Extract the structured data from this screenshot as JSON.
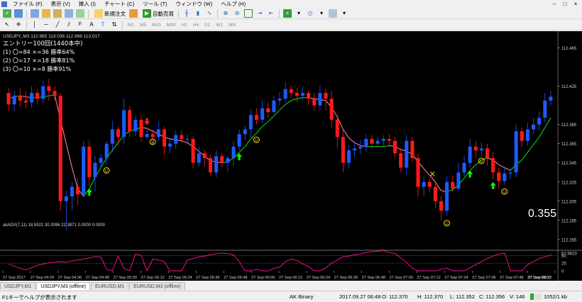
{
  "menu": {
    "items": [
      "ファイル (F)",
      "表示 (V)",
      "挿入 (I)",
      "チャート (C)",
      "ツール (T)",
      "ウィンドウ (W)",
      "ヘルプ (H)"
    ],
    "window_controls": [
      "–",
      "□",
      "×"
    ]
  },
  "toolbar": {
    "new_order": "新規注文",
    "auto_trading": "自動売買",
    "timeframes": [
      "M1",
      "M5",
      "M15",
      "M30",
      "H1",
      "H4",
      "D1",
      "W1",
      "MN"
    ]
  },
  "chart": {
    "header": "USDJPY,,M3   112.985 113.036 112.966 113.017",
    "info_lines": [
      "エントリー100回(1440本中)",
      "(1) 〇=84 ×=36 勝率64%",
      "(2) 〇=17 ×=18 勝率81%",
      "(3) 〇=10 ×=8 勝率91%"
    ],
    "big_value": "0.355",
    "indicator_label": "akADX(7,11) 18.5921 30.3096 22.3871 0.0000 0.0000",
    "colors": {
      "bull": "#1e5aff",
      "bear": "#ff1a1a",
      "ma_up": "#00d800",
      "ma_down": "#ff7a9a",
      "adx": "#ff1493",
      "up_arrow": "#00ff00",
      "down_arrow": "#ff2020",
      "smiley": "#ffd700",
      "bg": "#000000",
      "grid": "#252525"
    }
  },
  "chart_data": {
    "type": "candlestick",
    "symbol": "USDJPY",
    "timeframe": "M3",
    "price_ticks": [
      "112.465",
      "112.425",
      "112.385",
      "112.365",
      "112.345",
      "112.325",
      "112.305",
      "112.285",
      "112.265"
    ],
    "price_range": [
      112.256,
      112.478
    ],
    "time_labels": [
      "27 Sep 2017",
      "27 Sep 04:24",
      "27 Sep 04:36",
      "27 Sep 04:48",
      "27 Sep 05:00",
      "27 Sep 05:12",
      "27 Sep 05:24",
      "27 Sep 05:36",
      "27 Sep 05:48",
      "27 Sep 06:00",
      "27 Sep 06:12",
      "27 Sep 06:24",
      "27 Sep 06:36",
      "27 Sep 06:48",
      "27 Sep 07:00",
      "27 Sep 07:12",
      "27 Sep 07:24",
      "27 Sep 07:36",
      "27 Sep 07:48",
      "27 Sep 08:00",
      "27 Sep 08:12"
    ],
    "candles": [
      [
        112.418,
        112.406,
        112.423,
        112.399
      ],
      [
        112.406,
        112.415,
        112.42,
        112.399
      ],
      [
        112.415,
        112.41,
        112.423,
        112.404
      ],
      [
        112.41,
        112.408,
        112.42,
        112.402
      ],
      [
        112.408,
        112.418,
        112.425,
        112.403
      ],
      [
        112.418,
        112.412,
        112.422,
        112.406
      ],
      [
        112.412,
        112.425,
        112.431,
        112.407
      ],
      [
        112.425,
        112.42,
        112.433,
        112.41
      ],
      [
        112.42,
        112.415,
        112.425,
        112.41
      ],
      [
        112.415,
        112.305,
        112.418,
        112.295
      ],
      [
        112.305,
        112.31,
        112.316,
        112.275
      ],
      [
        112.31,
        112.32,
        112.325,
        112.295
      ],
      [
        112.32,
        112.312,
        112.329,
        112.301
      ],
      [
        112.312,
        112.362,
        112.368,
        112.309
      ],
      [
        112.362,
        112.33,
        112.369,
        112.321
      ],
      [
        112.33,
        112.345,
        112.352,
        112.315
      ],
      [
        112.345,
        112.35,
        112.354,
        112.34
      ],
      [
        112.35,
        112.365,
        112.368,
        112.343
      ],
      [
        112.365,
        112.38,
        112.389,
        112.356
      ],
      [
        112.38,
        112.372,
        112.383,
        112.363
      ],
      [
        112.372,
        112.4,
        112.412,
        112.365
      ],
      [
        112.4,
        112.378,
        112.404,
        112.372
      ],
      [
        112.378,
        112.39,
        112.394,
        112.373
      ],
      [
        112.39,
        112.372,
        112.395,
        112.367
      ],
      [
        112.372,
        112.375,
        112.38,
        112.37
      ],
      [
        112.375,
        112.372,
        112.38,
        112.364
      ],
      [
        112.372,
        112.38,
        112.388,
        112.368
      ],
      [
        112.38,
        112.362,
        112.383,
        112.353
      ],
      [
        112.362,
        112.365,
        112.37,
        112.355
      ],
      [
        112.365,
        112.374,
        112.379,
        112.36
      ],
      [
        112.374,
        112.37,
        112.379,
        112.366
      ],
      [
        112.37,
        112.37,
        112.375,
        112.364
      ],
      [
        112.37,
        112.345,
        112.373,
        112.339
      ],
      [
        112.345,
        112.355,
        112.362,
        112.341
      ],
      [
        112.355,
        112.35,
        112.359,
        112.341
      ],
      [
        112.35,
        112.335,
        112.354,
        112.332
      ],
      [
        112.335,
        112.352,
        112.358,
        112.33
      ],
      [
        112.352,
        112.345,
        112.355,
        112.34
      ],
      [
        112.345,
        112.35,
        112.353,
        112.336
      ],
      [
        112.35,
        112.362,
        112.368,
        112.342
      ],
      [
        112.362,
        112.375,
        112.38,
        112.358
      ],
      [
        112.375,
        112.38,
        112.384,
        112.369
      ],
      [
        112.38,
        112.395,
        112.401,
        112.372
      ],
      [
        112.395,
        112.39,
        112.402,
        112.385
      ],
      [
        112.39,
        112.402,
        112.41,
        112.386
      ],
      [
        112.402,
        112.398,
        112.408,
        112.392
      ],
      [
        112.398,
        112.41,
        112.415,
        112.396
      ],
      [
        112.41,
        112.412,
        112.419,
        112.405
      ],
      [
        112.412,
        112.422,
        112.43,
        112.408
      ],
      [
        112.422,
        112.418,
        112.426,
        112.412
      ],
      [
        112.418,
        112.415,
        112.423,
        112.409
      ],
      [
        112.415,
        112.418,
        112.425,
        112.411
      ],
      [
        112.418,
        112.412,
        112.421,
        112.405
      ],
      [
        112.412,
        112.405,
        112.418,
        112.399
      ],
      [
        112.405,
        112.418,
        112.426,
        112.4
      ],
      [
        112.418,
        112.412,
        112.422,
        112.4
      ],
      [
        112.412,
        112.39,
        112.42,
        112.382
      ],
      [
        112.39,
        112.372,
        112.395,
        112.36
      ],
      [
        112.372,
        112.345,
        112.379,
        112.335
      ],
      [
        112.345,
        112.358,
        112.364,
        112.339
      ],
      [
        112.358,
        112.36,
        112.367,
        112.351
      ],
      [
        112.36,
        112.362,
        112.369,
        112.354
      ],
      [
        112.362,
        112.37,
        112.375,
        112.357
      ],
      [
        112.37,
        112.365,
        112.374,
        112.36
      ],
      [
        112.365,
        112.368,
        112.372,
        112.362
      ],
      [
        112.368,
        112.37,
        112.374,
        112.362
      ],
      [
        112.37,
        112.368,
        112.375,
        112.362
      ],
      [
        112.368,
        112.355,
        112.372,
        112.349
      ],
      [
        112.355,
        112.34,
        112.36,
        112.335
      ],
      [
        112.34,
        112.368,
        112.374,
        112.332
      ],
      [
        112.368,
        112.35,
        112.372,
        112.346
      ],
      [
        112.35,
        112.32,
        112.355,
        112.31
      ],
      [
        112.32,
        112.325,
        112.331,
        112.31
      ],
      [
        112.325,
        112.32,
        112.329,
        112.315
      ],
      [
        112.32,
        112.305,
        112.325,
        112.298
      ],
      [
        112.305,
        112.295,
        112.31,
        112.285
      ],
      [
        112.295,
        112.325,
        112.331,
        112.29
      ],
      [
        112.325,
        112.318,
        112.332,
        112.314
      ],
      [
        112.318,
        112.335,
        112.345,
        112.315
      ],
      [
        112.335,
        112.345,
        112.352,
        112.331
      ],
      [
        112.345,
        112.362,
        112.37,
        112.34
      ],
      [
        112.362,
        112.358,
        112.368,
        112.35
      ],
      [
        112.358,
        112.36,
        112.366,
        112.352
      ],
      [
        112.36,
        112.35,
        112.365,
        112.342
      ],
      [
        112.35,
        112.335,
        112.356,
        112.328
      ],
      [
        112.335,
        112.326,
        112.34,
        112.318
      ],
      [
        112.326,
        112.334,
        112.34,
        112.322
      ],
      [
        112.334,
        112.335,
        112.34,
        112.328
      ],
      [
        112.335,
        112.378,
        112.385,
        112.33
      ],
      [
        112.378,
        112.368,
        112.382,
        112.362
      ],
      [
        112.368,
        112.38,
        112.387,
        112.363
      ],
      [
        112.38,
        112.385,
        112.392,
        112.375
      ],
      [
        112.385,
        112.392,
        112.399,
        112.379
      ],
      [
        112.392,
        112.41,
        112.418,
        112.387
      ],
      [
        112.41,
        112.414,
        112.42,
        112.405
      ]
    ],
    "ma": [
      112.412,
      112.414,
      112.415,
      112.414,
      112.413,
      112.413,
      112.414,
      112.415,
      112.416,
      112.39,
      112.365,
      112.34,
      112.318,
      112.31,
      112.318,
      112.33,
      112.34,
      112.35,
      112.358,
      112.366,
      112.374,
      112.378,
      112.38,
      112.382,
      112.381,
      112.378,
      112.375,
      112.372,
      112.37,
      112.369,
      112.368,
      112.366,
      112.362,
      112.357,
      112.352,
      112.347,
      112.346,
      112.345,
      112.346,
      112.35,
      112.356,
      112.362,
      112.37,
      112.376,
      112.383,
      112.388,
      112.394,
      112.4,
      112.406,
      112.41,
      112.412,
      112.413,
      112.413,
      112.412,
      112.411,
      112.41,
      112.403,
      112.393,
      112.38,
      112.371,
      112.366,
      112.363,
      112.362,
      112.362,
      112.362,
      112.362,
      112.363,
      112.362,
      112.359,
      112.357,
      112.354,
      112.346,
      112.339,
      112.332,
      112.325,
      112.316,
      112.315,
      112.317,
      112.322,
      112.329,
      112.337,
      112.343,
      112.348,
      112.35,
      112.348,
      112.343,
      112.34,
      112.337,
      112.343,
      112.348,
      112.356,
      112.364,
      112.372,
      112.382,
      112.392
    ],
    "signals_up": [
      14,
      40,
      80,
      84
    ],
    "signals_down": [
      24
    ],
    "smileys": [
      16,
      24,
      42,
      75,
      81,
      85
    ],
    "cross_marks": [
      73
    ],
    "indicator": {
      "name": "akADX(7,11)",
      "values": [
        18.5921,
        30.3096,
        22.3871,
        0.0,
        0.0
      ],
      "scale_ticks": [
        "57.9823",
        "50",
        "25",
        "0"
      ],
      "range": [
        0,
        60
      ],
      "levels": [
        50,
        25
      ],
      "line": [
        22,
        15,
        8,
        3,
        10,
        18,
        22,
        26,
        28,
        30,
        28,
        32,
        35,
        38,
        42,
        46,
        45,
        5,
        0,
        48,
        8,
        0,
        55,
        50,
        0,
        38,
        35,
        30,
        0,
        0,
        0,
        35,
        40,
        45,
        48,
        52,
        56,
        58,
        56,
        52,
        30,
        0,
        0,
        5,
        0,
        0,
        8,
        12,
        30,
        38,
        34,
        22,
        14,
        0,
        0,
        10,
        25,
        35,
        46,
        48,
        52,
        55,
        60,
        62,
        64,
        66,
        60,
        56,
        42,
        28,
        8,
        0,
        0,
        0,
        0,
        5,
        9,
        0,
        0,
        0,
        10,
        20,
        30,
        40,
        48,
        54,
        58,
        0,
        0,
        0,
        20,
        30,
        40,
        46,
        50,
        55
      ]
    }
  },
  "tabs": [
    "USDJPY,M1",
    "USDJPY,M3 (offline)",
    "EURUSD,M1",
    "EURUSD,M3 (offline)"
  ],
  "active_tab": 1,
  "status": {
    "help": "F1キーでヘルプが表示されます",
    "profile": "AK Binary",
    "time": "2017.09.27 06:48",
    "open": "O: 112.370",
    "high": "H: 112.370",
    "low": "L: 112.352",
    "close": "C: 112.356",
    "volume": "V: 146",
    "traffic": "1052/1 kb"
  }
}
